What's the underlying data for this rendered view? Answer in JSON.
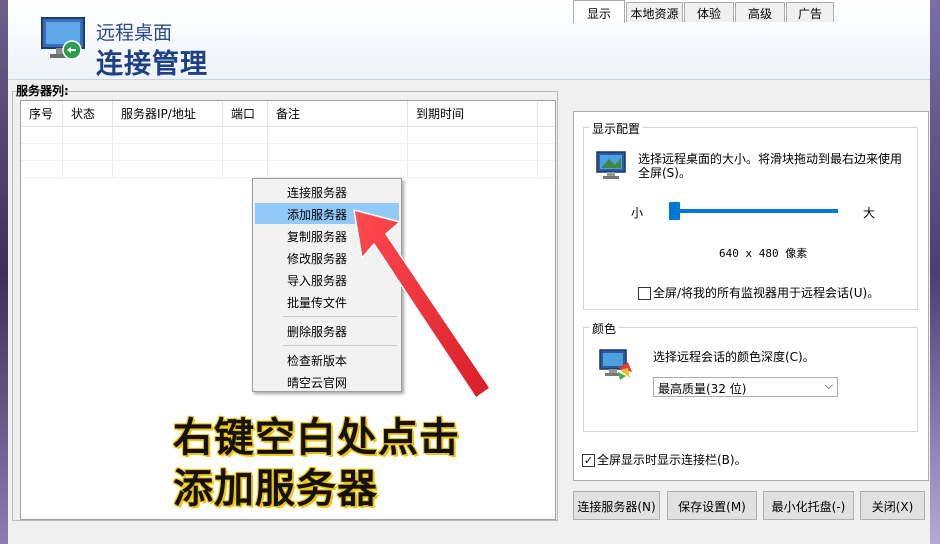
{
  "header": {
    "title_small": "远程桌面",
    "title_big": "连接管理",
    "icon": "remote-desktop-icon"
  },
  "server_list": {
    "label": "服务器列:",
    "columns": [
      "序号",
      "状态",
      "服务器IP/地址",
      "端口",
      "备注",
      "到期时间"
    ]
  },
  "context_menu": {
    "items": [
      "连接服务器",
      "添加服务器",
      "复制服务器",
      "修改服务器",
      "导入服务器",
      "批量传文件",
      "删除服务器",
      "检查新版本",
      "晴空云官网"
    ],
    "highlighted": "添加服务器"
  },
  "overlay": {
    "line1": "右键空白处点击",
    "line2": "添加服务器",
    "arrow_color": "#e8333a",
    "text_outline_color": "#f5c400"
  },
  "tabs": [
    "显示",
    "本地资源",
    "体验",
    "高级",
    "广告"
  ],
  "active_tab": "显示",
  "display_config": {
    "group_title": "显示配置",
    "description": "选择远程桌面的大小。将滑块拖动到最右边来使用全屏(S)。",
    "desc_line1": "选择远程桌面的大小。将滑块拖动到最右边来使用",
    "desc_line2": "全屏(S)。",
    "small_label": "小",
    "large_label": "大",
    "resolution": "640 x 480 像素",
    "slider_position": 0,
    "multi_monitor_label": "全屏/将我的所有监视器用于远程会话(U)。",
    "multi_monitor_checked": false
  },
  "color": {
    "group_title": "颜色",
    "description": "选择远程会话的颜色深度(C)。",
    "selected": "最高质量(32 位)"
  },
  "connection_bar": {
    "label": "全屏显示时显示连接栏(B)。",
    "checked": true,
    "check_mark": "✓"
  },
  "buttons": {
    "connect": "连接服务器(N)",
    "save": "保存设置(M)",
    "minimize": "最小化托盘(-)",
    "close": "关闭(X)"
  }
}
